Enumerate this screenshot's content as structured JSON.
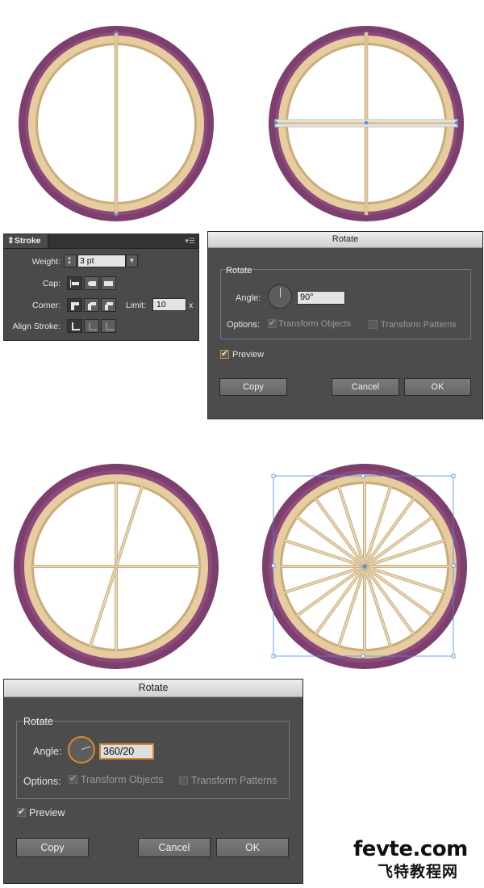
{
  "stroke_panel": {
    "title": "Stroke",
    "weight_label": "Weight:",
    "weight_value": "3 pt",
    "cap_label": "Cap:",
    "corner_label": "Corner:",
    "limit_label": "Limit:",
    "limit_value": "10",
    "limit_unit": "x",
    "align_label": "Align Stroke:"
  },
  "rotate_dialog_1": {
    "title": "Rotate",
    "section": "Rotate",
    "angle_label": "Angle:",
    "angle_value": "90°",
    "options_label": "Options:",
    "transform_objects": "Transform Objects",
    "transform_patterns": "Transform Patterns",
    "preview_label": "Preview",
    "copy_button": "Copy",
    "cancel_button": "Cancel",
    "ok_button": "OK"
  },
  "rotate_dialog_2": {
    "title": "Rotate",
    "section": "Rotate",
    "angle_label": "Angle:",
    "angle_value": "360/20",
    "options_label": "Options:",
    "transform_objects": "Transform Objects",
    "transform_patterns": "Transform Patterns",
    "preview_label": "Preview",
    "copy_button": "Copy",
    "cancel_button": "Cancel",
    "ok_button": "OK"
  },
  "watermark": {
    "site": "fevte.com",
    "chinese": "飞特教程网"
  },
  "colors": {
    "tire": "#7d3f6e",
    "rim": "#e6cc9f",
    "spoke": "#dec79d",
    "selection": "#4a90e2",
    "dialog_bg": "#4c4c4c",
    "focus": "#d88a2b"
  }
}
